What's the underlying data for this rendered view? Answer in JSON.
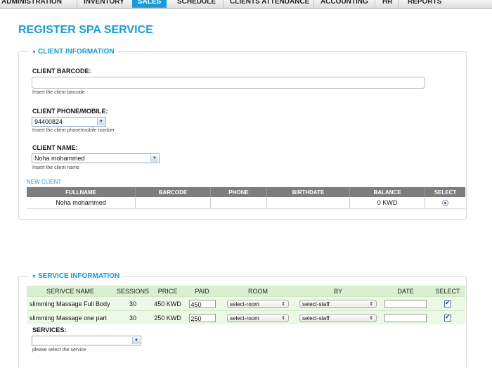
{
  "nav": {
    "tabs": [
      "ADMINISTRATION",
      "INVENTORY",
      "SALES",
      "SCHEDULE",
      "CLIENTS ATTENDANCE",
      "ACCOUNTING",
      "HR",
      "REPORTS"
    ],
    "active": "SALES"
  },
  "page_title": "REGISTER SPA SERVICE",
  "client_info": {
    "legend": "CLIENT INFORMATION",
    "barcode": {
      "label": "CLIENT BARCODE:",
      "value": "",
      "hint": "Insert the client barcode"
    },
    "phone": {
      "label": "CLIENT PHONE/MOBILE:",
      "value": "94400824",
      "hint": "Insert the client phone/mobile number"
    },
    "name": {
      "label": "CLIENT NAME:",
      "value": "Noha mohammed",
      "hint": "Insert the client name"
    },
    "new_client_link": "NEW CLIENT",
    "table": {
      "headers": [
        "FULLNAME",
        "BARCODE",
        "PHONE",
        "BIRTHDATE",
        "BALANCE",
        "SELECT"
      ],
      "rows": [
        {
          "fullname": "Noha mohammed",
          "barcode": "",
          "phone": "",
          "birthdate": "",
          "balance": "0 KWD",
          "selected": true
        }
      ]
    }
  },
  "service_info": {
    "legend": "SERVICE INFORMATION",
    "table": {
      "headers": [
        "SERIVCE NAME",
        "SESSIONS",
        "PRICE",
        "PAID",
        "ROOM",
        "BY",
        "DATE",
        "SELECT"
      ],
      "rows": [
        {
          "name": "slimming Massage Full Body",
          "sessions": "30",
          "price": "450 KWD",
          "paid": "450",
          "room": "select-room",
          "by": "select-staff",
          "date": "",
          "selected": true
        },
        {
          "name": "slimming Massage one part",
          "sessions": "30",
          "price": "250 KWD",
          "paid": "250",
          "room": "select-room",
          "by": "select-staff",
          "date": "",
          "selected": true
        }
      ]
    },
    "services": {
      "label": "SERVICES:",
      "value": "",
      "hint": "please select the service"
    }
  }
}
